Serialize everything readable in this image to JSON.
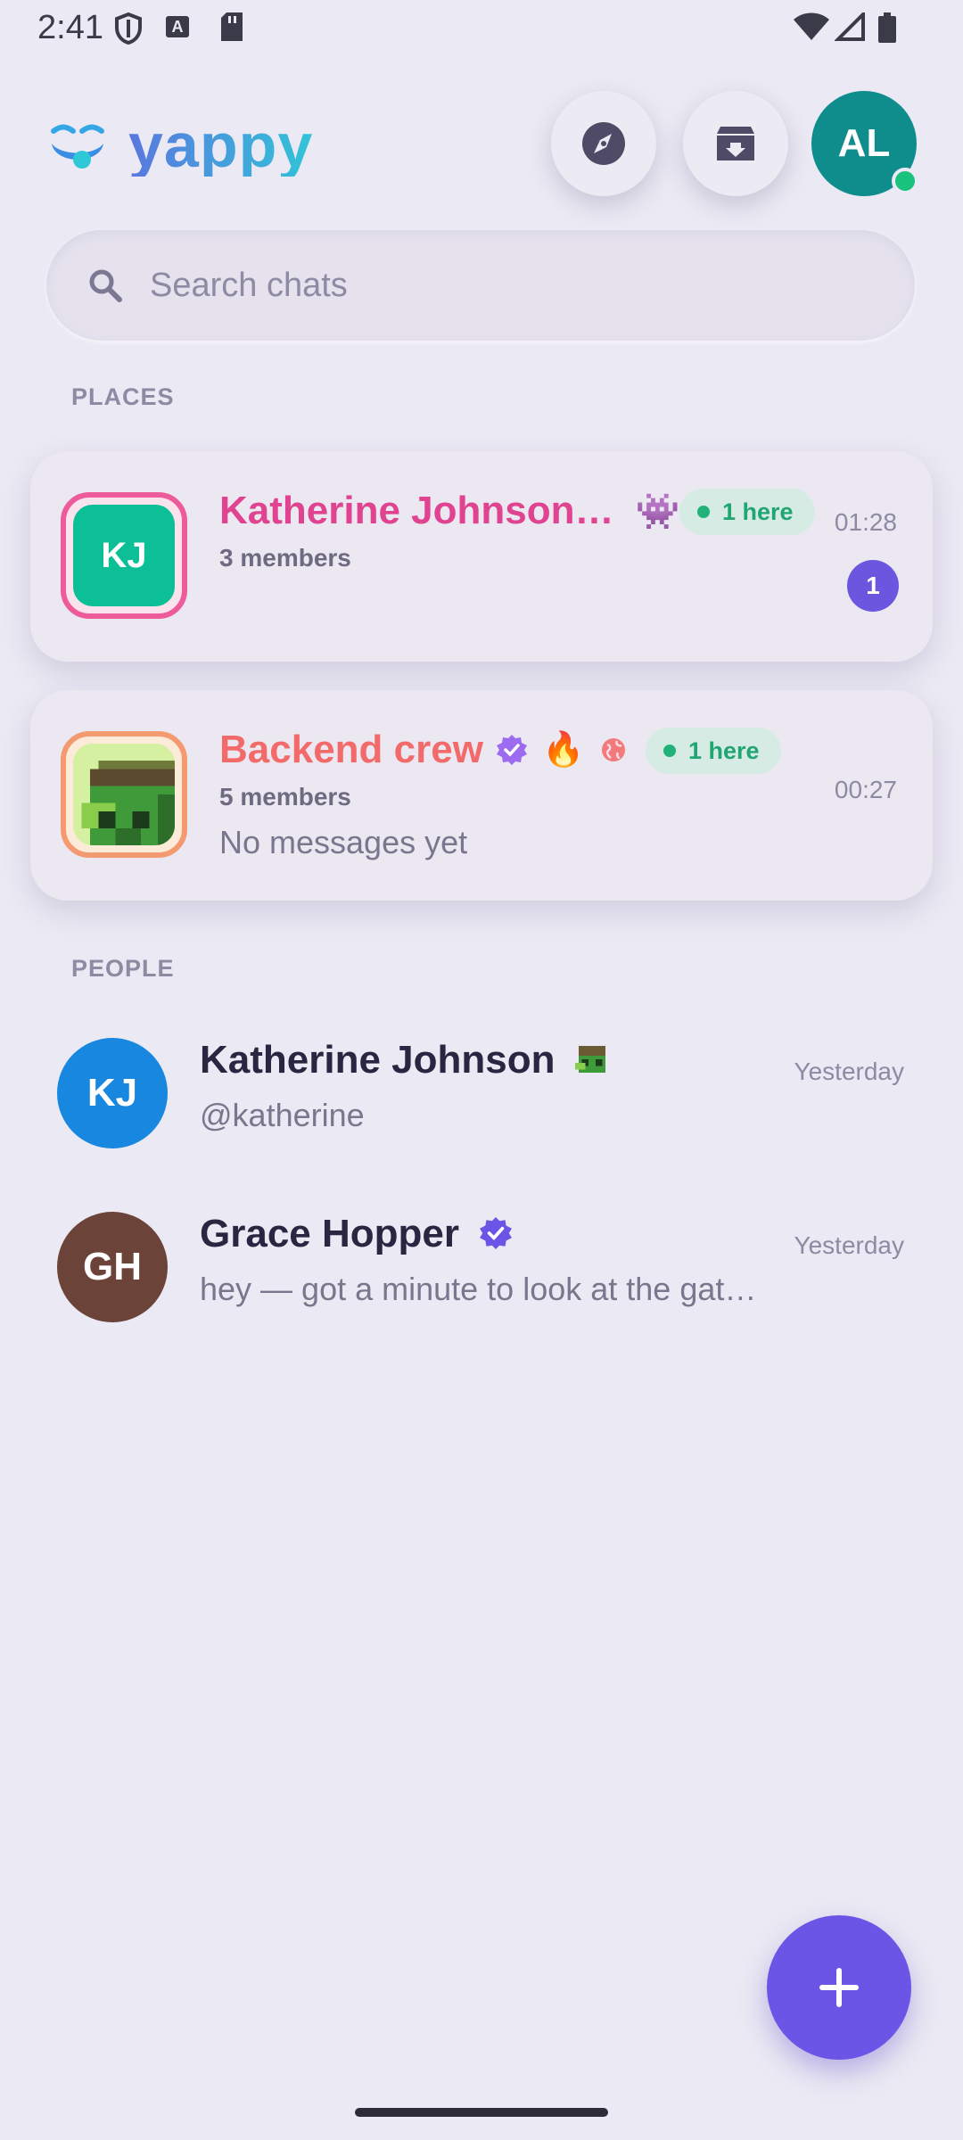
{
  "status_bar": {
    "time": "2:41",
    "a_badge": "A"
  },
  "header": {
    "logo_text": "yappy",
    "profile_initials": "AL"
  },
  "search": {
    "placeholder": "Search chats"
  },
  "places": {
    "label": "PLACES",
    "items": [
      {
        "initials": "KJ",
        "name": "Katherine Johnson…",
        "emoji": "👾",
        "here": "1 here",
        "members": "3 members",
        "time": "01:28",
        "unread": "1"
      },
      {
        "name": "Backend crew",
        "emoji": "🔥",
        "here": "1 here",
        "members": "5 members",
        "time": "00:27",
        "preview": "No messages yet"
      }
    ]
  },
  "people": {
    "label": "PEOPLE",
    "items": [
      {
        "initials": "KJ",
        "name": "Katherine Johnson",
        "sub": "@katherine",
        "time": "Yesterday",
        "avatar_color": "#1787e0"
      },
      {
        "initials": "GH",
        "name": "Grace Hopper",
        "sub": "hey — got a minute to look at the gate…",
        "time": "Yesterday",
        "avatar_color": "#6b4338"
      }
    ]
  },
  "colors": {
    "accent": "#6b55e6",
    "online": "#19c37d",
    "place1_name": "#e0438f",
    "place2_name": "#f26a6a"
  }
}
